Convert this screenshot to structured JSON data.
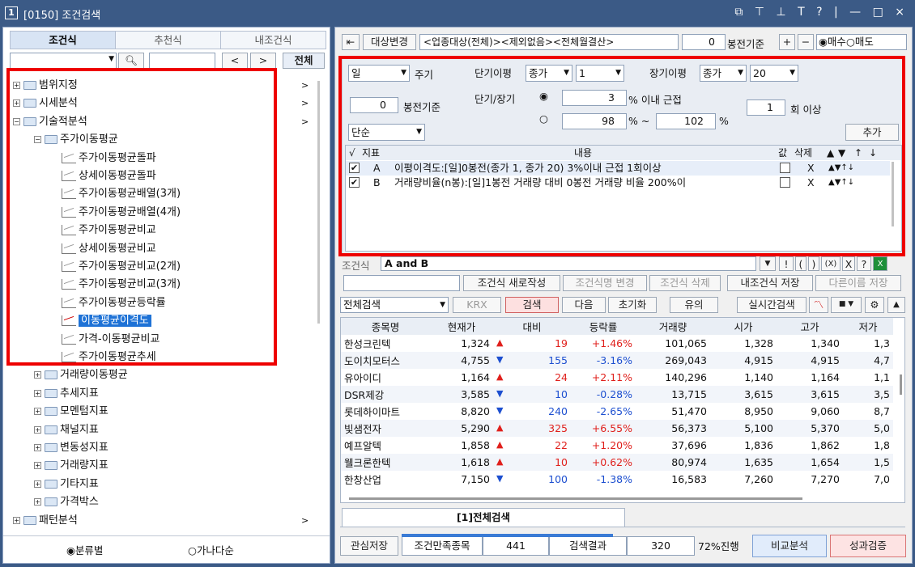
{
  "window": {
    "num": "1",
    "title": "[0150] 조건검색",
    "controls": "⧉ ⊤ ⊥ T ? | — □ ×"
  },
  "left": {
    "tabs": [
      "조건식",
      "추천식",
      "내조건식"
    ],
    "search_prev": "<",
    "search_next": ">",
    "all_btn": "전체",
    "tree": [
      {
        "label": "범위지정",
        "level": 0,
        "pm": "+",
        "arrow": ">"
      },
      {
        "label": "시세분석",
        "level": 0,
        "pm": "+",
        "arrow": ">"
      },
      {
        "label": "기술적분석",
        "level": 0,
        "pm": "−",
        "arrow": ">"
      },
      {
        "label": "주가이동평균",
        "level": 1,
        "pm": "−"
      },
      {
        "label": "주가이동평균돌파",
        "level": 2
      },
      {
        "label": "상세이동평균돌파",
        "level": 2
      },
      {
        "label": "주가이동평균배열(3개)",
        "level": 2
      },
      {
        "label": "주가이동평균배열(4개)",
        "level": 2
      },
      {
        "label": "주가이동평균비교",
        "level": 2
      },
      {
        "label": "상세이동평균비교",
        "level": 2
      },
      {
        "label": "주가이동평균비교(2개)",
        "level": 2
      },
      {
        "label": "주가이동평균비교(3개)",
        "level": 2
      },
      {
        "label": "주가이동평균등락률",
        "level": 2
      },
      {
        "label": "이동평균이격도",
        "level": 2,
        "selected": true
      },
      {
        "label": "가격-이동평균비교",
        "level": 2
      },
      {
        "label": "주가이동평균추세",
        "level": 2
      },
      {
        "label": "거래량이동평균",
        "level": 1,
        "pm": "+"
      },
      {
        "label": "추세지표",
        "level": 1,
        "pm": "+"
      },
      {
        "label": "모멘텀지표",
        "level": 1,
        "pm": "+"
      },
      {
        "label": "채널지표",
        "level": 1,
        "pm": "+"
      },
      {
        "label": "변동성지표",
        "level": 1,
        "pm": "+"
      },
      {
        "label": "거래량지표",
        "level": 1,
        "pm": "+"
      },
      {
        "label": "기타지표",
        "level": 1,
        "pm": "+"
      },
      {
        "label": "가격박스",
        "level": 1,
        "pm": "+"
      },
      {
        "label": "패턴분석",
        "level": 0,
        "pm": "+",
        "arrow": ">"
      }
    ],
    "radio_category": "분류별",
    "radio_alpha": "가나다순"
  },
  "right": {
    "target_btn": "대상변경",
    "target_value": "<업종대상(전체)><제외없음><전체월결산>",
    "bong_value": "0",
    "bong_label": "봉전기준",
    "plus": "+",
    "minus": "−",
    "buy": "매수",
    "sell": "매도",
    "period_value": "일",
    "period_label": "주기",
    "short_label": "단기이평",
    "short_type": "종가",
    "short_n": "1",
    "long_label": "장기이평",
    "long_type": "종가",
    "long_n": "20",
    "bong2_value": "0",
    "bong2_label": "봉전기준",
    "ratio_label": "단기/장기",
    "near_value": "3",
    "near_unit": "% 이내 근접",
    "range_from": "98",
    "range_mid": "% ~",
    "range_to": "102",
    "range_unit": "%",
    "times_value": "1",
    "times_label": "회 이상",
    "method_value": "단순",
    "add_btn": "추가",
    "cond_headers": [
      "√",
      "지표",
      "내용",
      "값",
      "삭제",
      "▲",
      "▼",
      "↑",
      "↓"
    ],
    "conditions": [
      {
        "id": "A",
        "text": "이평이격도:[일]0봉전(종가 1, 종가 20) 3%이내 근접 1회이상",
        "del": "X"
      },
      {
        "id": "B",
        "text": "거래량비율(n봉):[일]1봉전 거래량 대비 0봉전 거래량 비율 200%이",
        "del": "X"
      }
    ],
    "cond_formula_label": "조건식",
    "cond_formula": "A and B",
    "formula_btns": [
      "!",
      "(",
      ")",
      "(X)",
      "X",
      "?"
    ],
    "new_btn": "조건식 새로작성",
    "rename_btn": "조건식명 변경",
    "delete_btn": "조건식 삭제",
    "save_btn": "내조건식 저장",
    "saveas_btn": "다른이름 저장",
    "scope_value": "전체검색",
    "krx": "KRX",
    "search_btn": "검색",
    "next_btn": "다음",
    "reset_btn": "초기화",
    "note_btn": "유의",
    "realtime_btn": "실시간검색",
    "result_headers": [
      "종목명",
      "현재가",
      "대비",
      "등락률",
      "거래량",
      "시가",
      "고가",
      "저가"
    ],
    "results": [
      {
        "name": "한성크린텍",
        "price": "1,324",
        "dir": "up",
        "chg": "19",
        "pct": "+1.46%",
        "vol": "101,065",
        "open": "1,328",
        "high": "1,340",
        "low": "1,3"
      },
      {
        "name": "도이치모터스",
        "price": "4,755",
        "dir": "dn",
        "chg": "155",
        "pct": "-3.16%",
        "vol": "269,043",
        "open": "4,915",
        "high": "4,915",
        "low": "4,7"
      },
      {
        "name": "유아이디",
        "price": "1,164",
        "dir": "up",
        "chg": "24",
        "pct": "+2.11%",
        "vol": "140,296",
        "open": "1,140",
        "high": "1,164",
        "low": "1,1"
      },
      {
        "name": "DSR제강",
        "price": "3,585",
        "dir": "dn",
        "chg": "10",
        "pct": "-0.28%",
        "vol": "13,715",
        "open": "3,615",
        "high": "3,615",
        "low": "3,5"
      },
      {
        "name": "롯데하이마트",
        "price": "8,820",
        "dir": "dn",
        "chg": "240",
        "pct": "-2.65%",
        "vol": "51,470",
        "open": "8,950",
        "high": "9,060",
        "low": "8,7"
      },
      {
        "name": "빛샘전자",
        "price": "5,290",
        "dir": "up",
        "chg": "325",
        "pct": "+6.55%",
        "vol": "56,373",
        "open": "5,100",
        "high": "5,370",
        "low": "5,0"
      },
      {
        "name": "예프알텍",
        "price": "1,858",
        "dir": "up",
        "chg": "22",
        "pct": "+1.20%",
        "vol": "37,696",
        "open": "1,836",
        "high": "1,862",
        "low": "1,8"
      },
      {
        "name": "웰크론한텍",
        "price": "1,618",
        "dir": "up",
        "chg": "10",
        "pct": "+0.62%",
        "vol": "80,974",
        "open": "1,635",
        "high": "1,654",
        "low": "1,5"
      },
      {
        "name": "한창산업",
        "price": "7,150",
        "dir": "dn",
        "chg": "100",
        "pct": "-1.38%",
        "vol": "16,583",
        "open": "7,260",
        "high": "7,270",
        "low": "7,0"
      }
    ],
    "result_tab": "[1]전체검색",
    "watch_btn": "관심저장",
    "match_label": "조건만족종목",
    "match_value": "441",
    "result_label": "검색결과",
    "result_value": "320",
    "progress_pct": 72,
    "progress_text": "72%진행",
    "compare_btn": "비교분석",
    "perf_btn": "성과검증"
  }
}
